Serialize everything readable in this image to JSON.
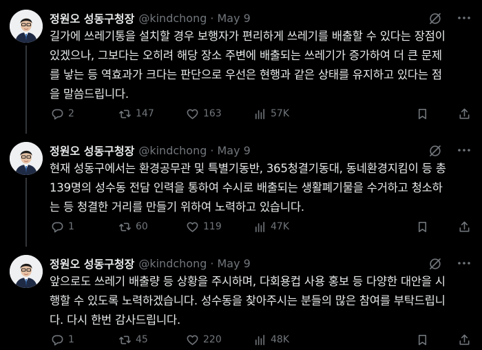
{
  "tweets": [
    {
      "name": "정원오 성동구청장",
      "handle": "@kindchong",
      "separator": "·",
      "date": "May 9",
      "text": "길가에 쓰레기통을 설치할 경우 보행자가 편리하게 쓰레기를 배출할 수 있다는 장점이\n있겠으나, 그보다는 오히려 해당 장소 주변에 배출되는 쓰레기가 증가하여 더 큰 문제\n를 낳는 등 역효과가 크다는 판단으로 우선은 현행과 같은 상태를 유지하고 있다는 점\n을 말씀드립니다.",
      "replies": "2",
      "retweets": "147",
      "likes": "163",
      "views": "57K"
    },
    {
      "name": "정원오 성동구청장",
      "handle": "@kindchong",
      "separator": "·",
      "date": "May 9",
      "text": "현재 성동구에서는 환경공무관 및 특별기동반, 365청결기동대, 동네환경지킴이 등 총\n139명의 성수동 전담 인력을 통하여 수시로 배출되는 생활폐기물을 수거하고 청소하\n는 등 청결한 거리를 만들기 위하여 노력하고 있습니다.",
      "replies": "1",
      "retweets": "60",
      "likes": "119",
      "views": "47K"
    },
    {
      "name": "정원오 성동구청장",
      "handle": "@kindchong",
      "separator": "·",
      "date": "May 9",
      "text": "앞으로도 쓰레기 배출량 등 상황을 주시하며, 다회용컵 사용 홍보 등 다양한 대안을 시\n행할 수 있도록 노력하겠습니다. 성수동을 찾아주시는 분들의 많은 참여를 부탁드립니\n다. 다시 한번 감사드립니다.",
      "replies": "1",
      "retweets": "45",
      "likes": "220",
      "views": "48K"
    }
  ],
  "icons": {
    "reply": "reply-icon",
    "retweet": "retweet-icon",
    "like": "heart-icon",
    "views": "views-icon",
    "bookmark": "bookmark-icon",
    "share": "share-icon",
    "grok": "grok-icon",
    "more": "more-icon"
  },
  "colors": {
    "background": "#000000",
    "text": "#e7e9ea",
    "muted": "#71767b",
    "thread_line": "#333639"
  }
}
